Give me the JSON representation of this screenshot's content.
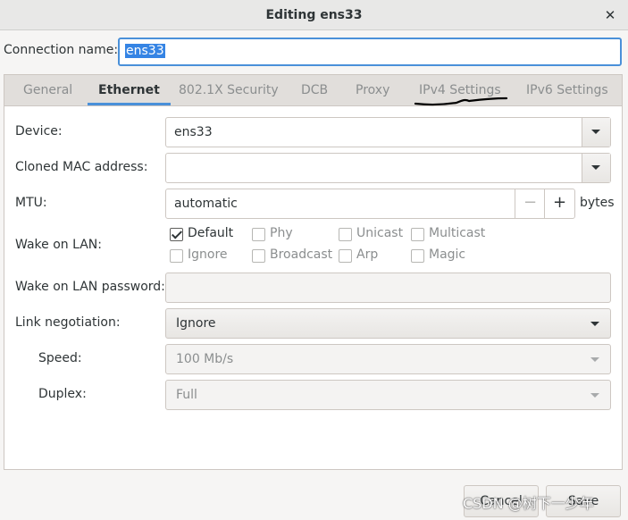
{
  "window": {
    "title": "Editing ens33",
    "close_glyph": "✕"
  },
  "connection": {
    "label": "Connection name:",
    "value": "ens33"
  },
  "tabs": [
    {
      "label": "General"
    },
    {
      "label": "Ethernet"
    },
    {
      "label": "802.1X Security"
    },
    {
      "label": "DCB"
    },
    {
      "label": "Proxy"
    },
    {
      "label": "IPv4 Settings"
    },
    {
      "label": "IPv6 Settings"
    }
  ],
  "active_tab": "Ethernet",
  "ethernet": {
    "device": {
      "label": "Device:",
      "value": "ens33"
    },
    "cloned_mac": {
      "label": "Cloned MAC address:",
      "value": ""
    },
    "mtu": {
      "label": "MTU:",
      "value": "automatic",
      "minus": "−",
      "plus": "+",
      "unit": "bytes"
    },
    "wake_on_lan": {
      "label": "Wake on LAN:",
      "options": [
        {
          "label": "Default",
          "checked": true,
          "enabled": true
        },
        {
          "label": "Phy",
          "checked": false,
          "enabled": false
        },
        {
          "label": "Unicast",
          "checked": false,
          "enabled": false
        },
        {
          "label": "Multicast",
          "checked": false,
          "enabled": false
        },
        {
          "label": "Ignore",
          "checked": false,
          "enabled": false
        },
        {
          "label": "Broadcast",
          "checked": false,
          "enabled": false
        },
        {
          "label": "Arp",
          "checked": false,
          "enabled": false
        },
        {
          "label": "Magic",
          "checked": false,
          "enabled": false
        }
      ]
    },
    "wol_password": {
      "label": "Wake on LAN password:",
      "value": ""
    },
    "link_negotiation": {
      "label": "Link negotiation:",
      "value": "Ignore"
    },
    "speed": {
      "label": "Speed:",
      "value": "100 Mb/s"
    },
    "duplex": {
      "label": "Duplex:",
      "value": "Full"
    }
  },
  "buttons": {
    "cancel": "Cancel",
    "save": "Save"
  },
  "watermark": "CSDN @树下一少年",
  "colors": {
    "accent": "#4a90d9",
    "selection": "#3584e4",
    "annotation": "#000000"
  }
}
